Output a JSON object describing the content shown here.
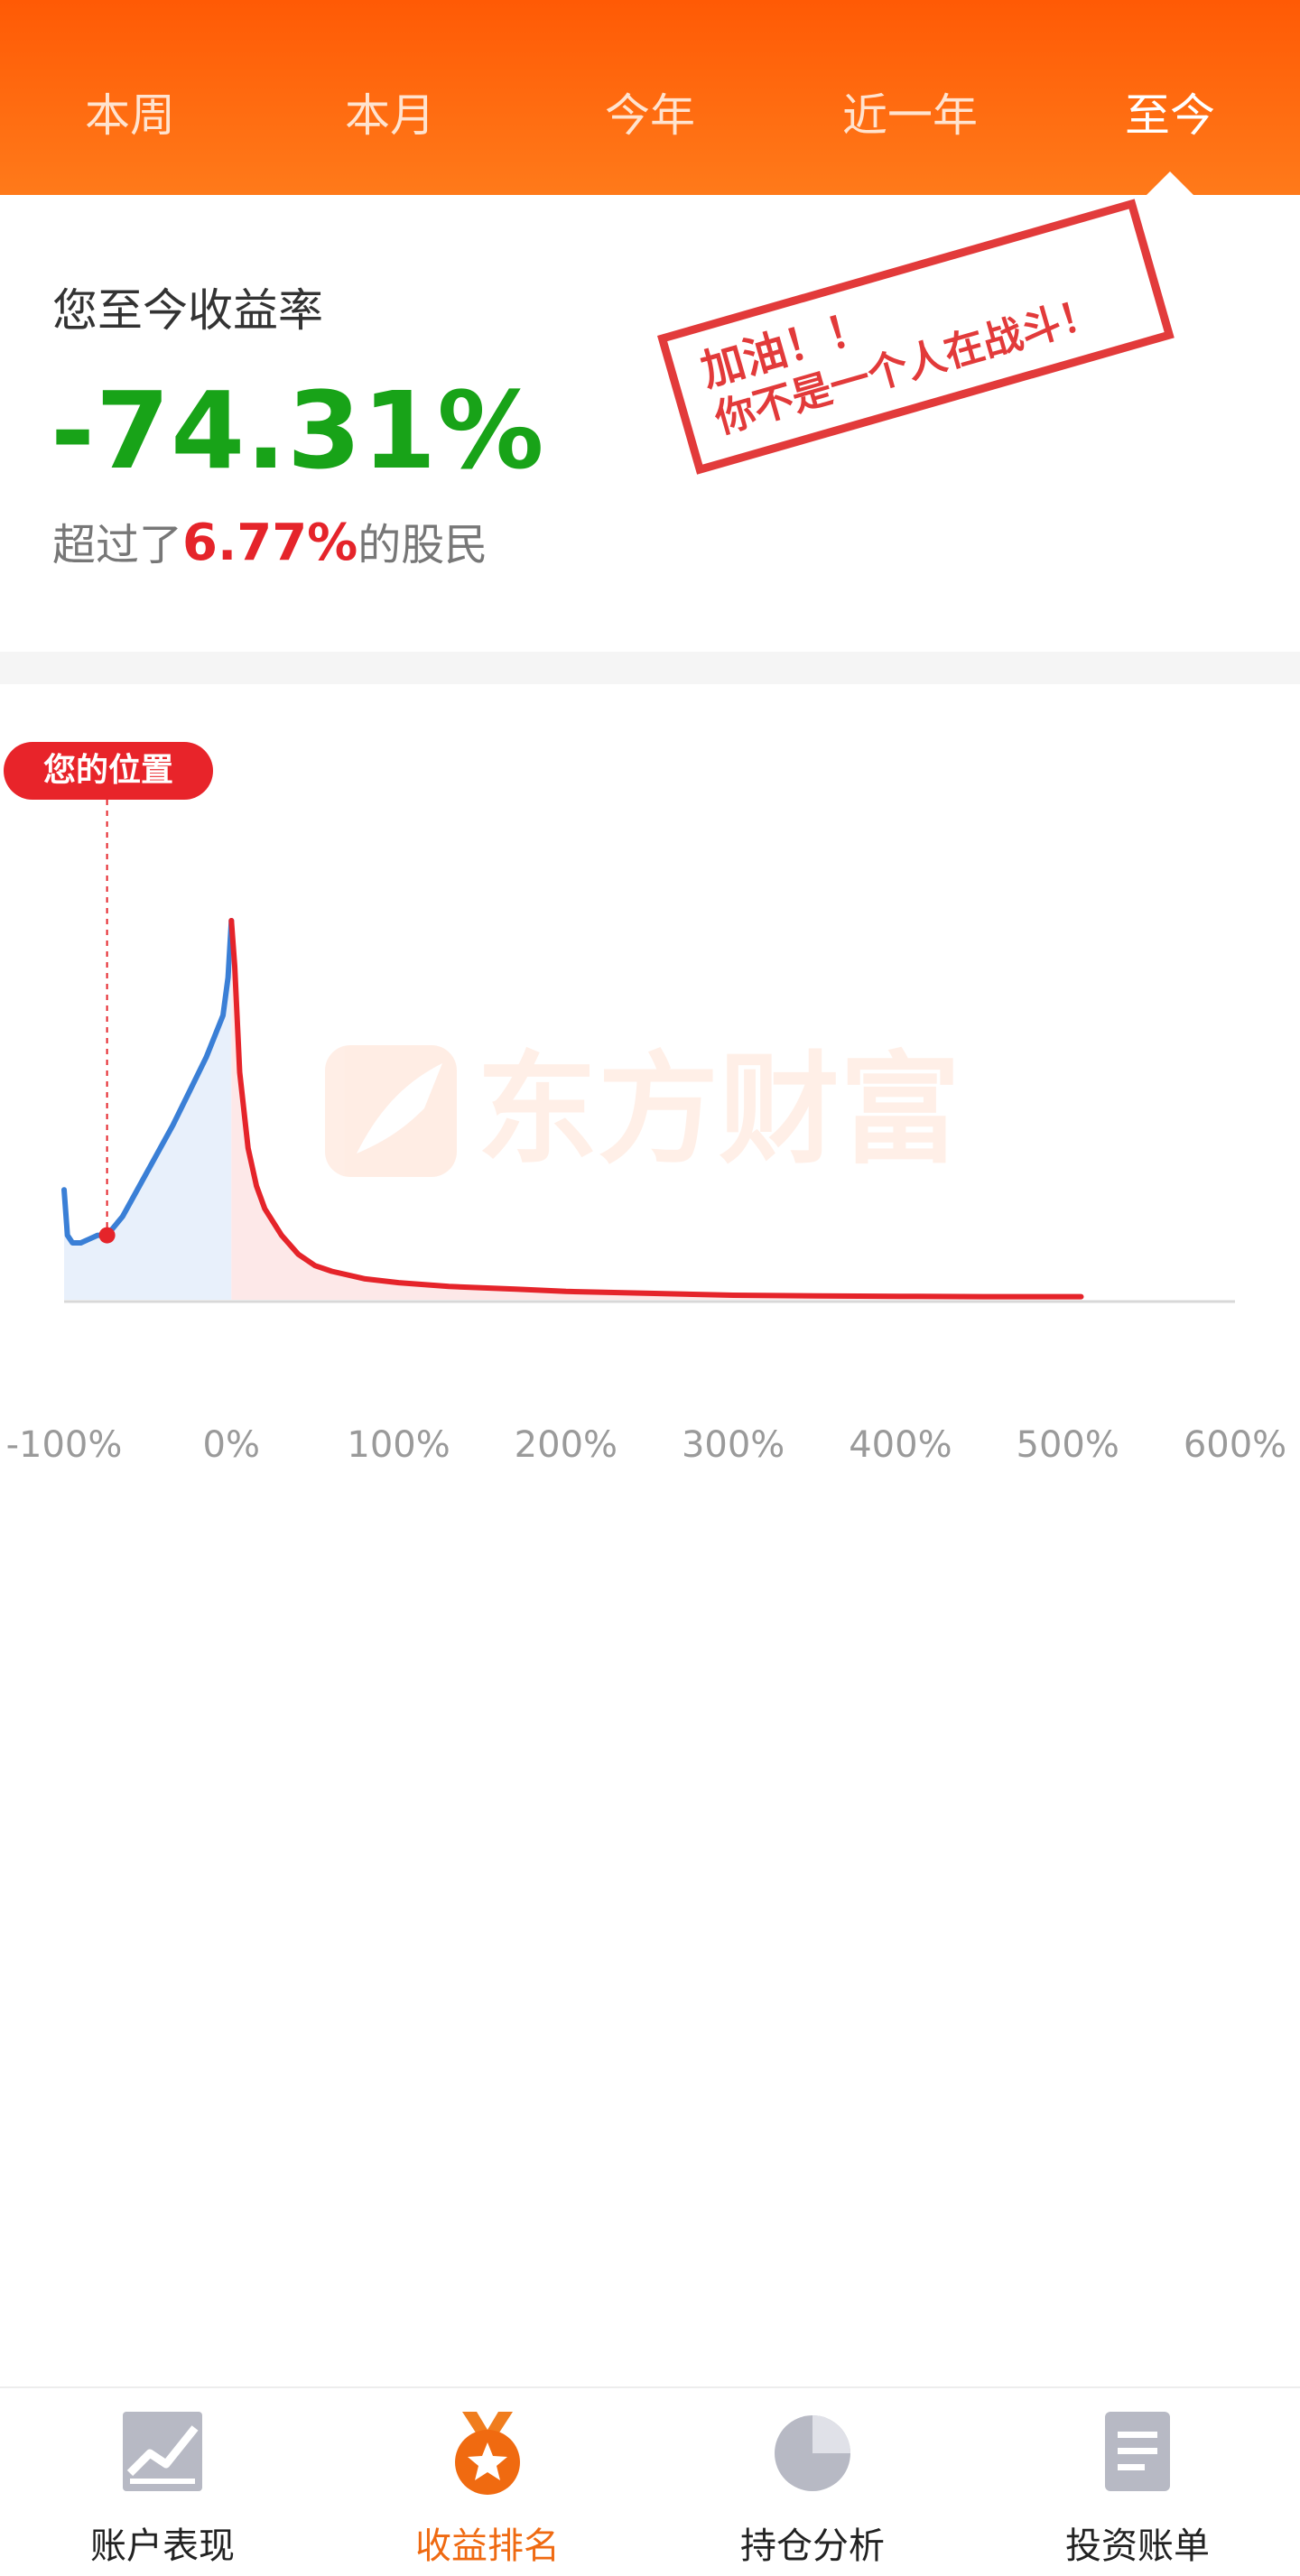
{
  "tabs": [
    {
      "label": "本周",
      "active": false
    },
    {
      "label": "本月",
      "active": false
    },
    {
      "label": "今年",
      "active": false
    },
    {
      "label": "近一年",
      "active": false
    },
    {
      "label": "至今",
      "active": true
    }
  ],
  "summary": {
    "label": "您至今收益率",
    "rate": "-74.31%",
    "beat_prefix": "超过了",
    "beat_pct": "6.77%",
    "beat_suffix": "的股民"
  },
  "stamp": {
    "line1": "加油！！",
    "line2": "你不是一个人在战斗！"
  },
  "position_badge": "您的位置",
  "watermark": "东方财富",
  "colors": {
    "brand": "#ff5a05",
    "positive": "#e5242a",
    "negative": "#18a318",
    "loss_curve": "#3a7fd6",
    "gain_curve": "#e5242a",
    "nav_active": "#ef6a12"
  },
  "chart_data": {
    "type": "area",
    "x_ticks": [
      "-100%",
      "0%",
      "100%",
      "200%",
      "300%",
      "400%",
      "500%",
      "600%"
    ],
    "xlim": [
      -100,
      600
    ],
    "marker": {
      "x": -74.31
    },
    "series": [
      {
        "x": [
          -100,
          -98,
          -95,
          -90,
          -85,
          -80,
          -74.31,
          -65,
          -55,
          -45,
          -35,
          -25,
          -15,
          -5,
          -2,
          0
        ],
        "y": [
          0.29,
          0.17,
          0.15,
          0.15,
          0.16,
          0.17,
          0.17,
          0.22,
          0.3,
          0.38,
          0.46,
          0.55,
          0.64,
          0.75,
          0.85,
          1.0
        ]
      },
      {
        "x": [
          0,
          2,
          5,
          10,
          15,
          20,
          30,
          40,
          50,
          60,
          80,
          100,
          130,
          170,
          200,
          250,
          300,
          350,
          400,
          450,
          500,
          508
        ],
        "y": [
          1.0,
          0.88,
          0.6,
          0.4,
          0.3,
          0.24,
          0.17,
          0.12,
          0.09,
          0.075,
          0.055,
          0.045,
          0.035,
          0.028,
          0.022,
          0.017,
          0.012,
          0.01,
          0.009,
          0.008,
          0.008,
          0.008
        ]
      }
    ]
  },
  "nav": [
    {
      "label": "账户表现",
      "icon": "trend-chart-icon",
      "active": false
    },
    {
      "label": "收益排名",
      "icon": "medal-icon",
      "active": true
    },
    {
      "label": "持仓分析",
      "icon": "pie-chart-icon",
      "active": false
    },
    {
      "label": "投资账单",
      "icon": "bill-icon",
      "active": false
    }
  ]
}
